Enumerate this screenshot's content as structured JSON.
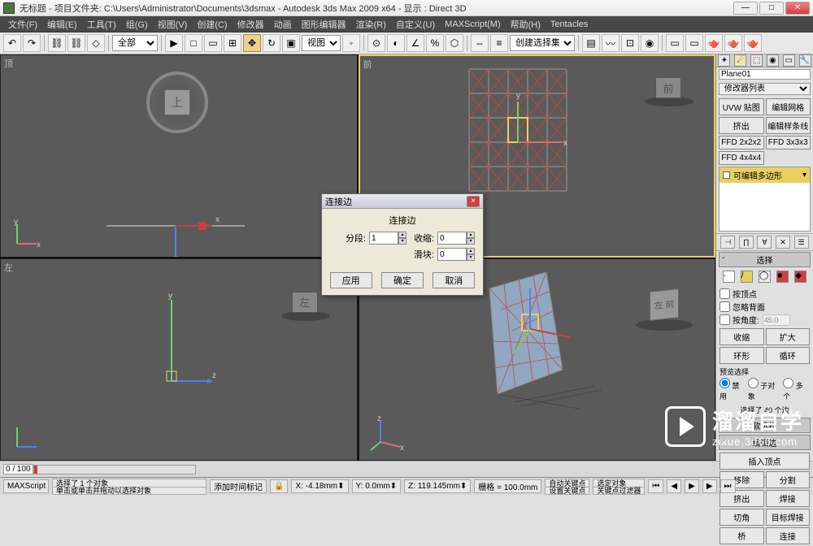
{
  "title": "无标题  - 项目文件夹: C:\\Users\\Administrator\\Documents\\3dsmax    - Autodesk 3ds Max  2009 x64    - 显示 : Direct 3D",
  "menus": [
    "文件(F)",
    "编辑(E)",
    "工具(T)",
    "组(G)",
    "视图(V)",
    "创建(C)",
    "修改器",
    "动画",
    "图形编辑器",
    "渲染(R)",
    "自定义(U)",
    "MAXScript(M)",
    "帮助(H)",
    "Tentacles"
  ],
  "toolbar": {
    "combo1": "全部",
    "combo2": "视图",
    "combo3": "创建选择集"
  },
  "viewports": {
    "top": "顶",
    "front": "前",
    "left": "左",
    "persp": "",
    "face_top": "上",
    "face_front": "前",
    "face_left": "左",
    "axis_x": "x",
    "axis_y": "y",
    "axis_z": "z"
  },
  "dialog": {
    "title": "连接边",
    "subtitle": "连接边",
    "seg_label": "分段:",
    "seg_value": "1",
    "pinch_label": "收缩:",
    "pinch_value": "0",
    "slide_label": "滑块:",
    "slide_value": "0",
    "apply": "应用",
    "ok": "确定",
    "cancel": "取消"
  },
  "panel": {
    "obj_name": "Plane01",
    "modlist": "修改器列表",
    "btn_uvw": "UVW 贴图",
    "btn_editmesh": "编辑网格",
    "btn_extrude": "挤出",
    "btn_editspline": "编辑样条线",
    "btn_ffd2": "FFD 2x2x2",
    "btn_ffd3": "FFD 3x3x3",
    "btn_ffd4": "FFD 4x4x4",
    "stack_item": "可编辑多边形",
    "sec_select": "选择",
    "chk_vertex": "按顶点",
    "chk_backface": "忽略背面",
    "chk_angle": "按角度:",
    "angle_val": "45.0",
    "btn_shrink": "收缩",
    "btn_grow": "扩大",
    "btn_ring": "环形",
    "btn_loop": "循环",
    "preview_sel": "预览选择",
    "rb_disable": "禁用",
    "rb_subobj": "子对象",
    "rb_multi": "多个",
    "sel_count": "选择了 40 个边",
    "sec_soft": "软选择",
    "sec_editedge": "编辑边",
    "btn_insert_vert": "插入顶点",
    "btn_remove": "移除",
    "btn_split": "分割",
    "btn_extrude2": "挤出",
    "btn_weld": "焊接",
    "btn_chamfer": "切角",
    "btn_target_weld": "目标焊接",
    "btn_bridge": "桥",
    "btn_connect": "连接"
  },
  "status": {
    "selected": "选择了 1 个对象",
    "hint": "单击或单击并拖动以选择对象",
    "x": "X: -4.18mm",
    "y": "Y: 0.0mm",
    "z": "Z: 119.145mm",
    "grid": "栅格 = 100.0mm",
    "autokey": "自动关键点",
    "selected_filter": "选定对象",
    "timeline": "0 / 100",
    "script": "MAXScript",
    "addtime": "添加时间标记",
    "setkey": "设置关键点",
    "keyfilter": "关键点过滤器"
  },
  "watermark": {
    "big": "溜溜自学",
    "url": "zixue.3d66.com"
  }
}
